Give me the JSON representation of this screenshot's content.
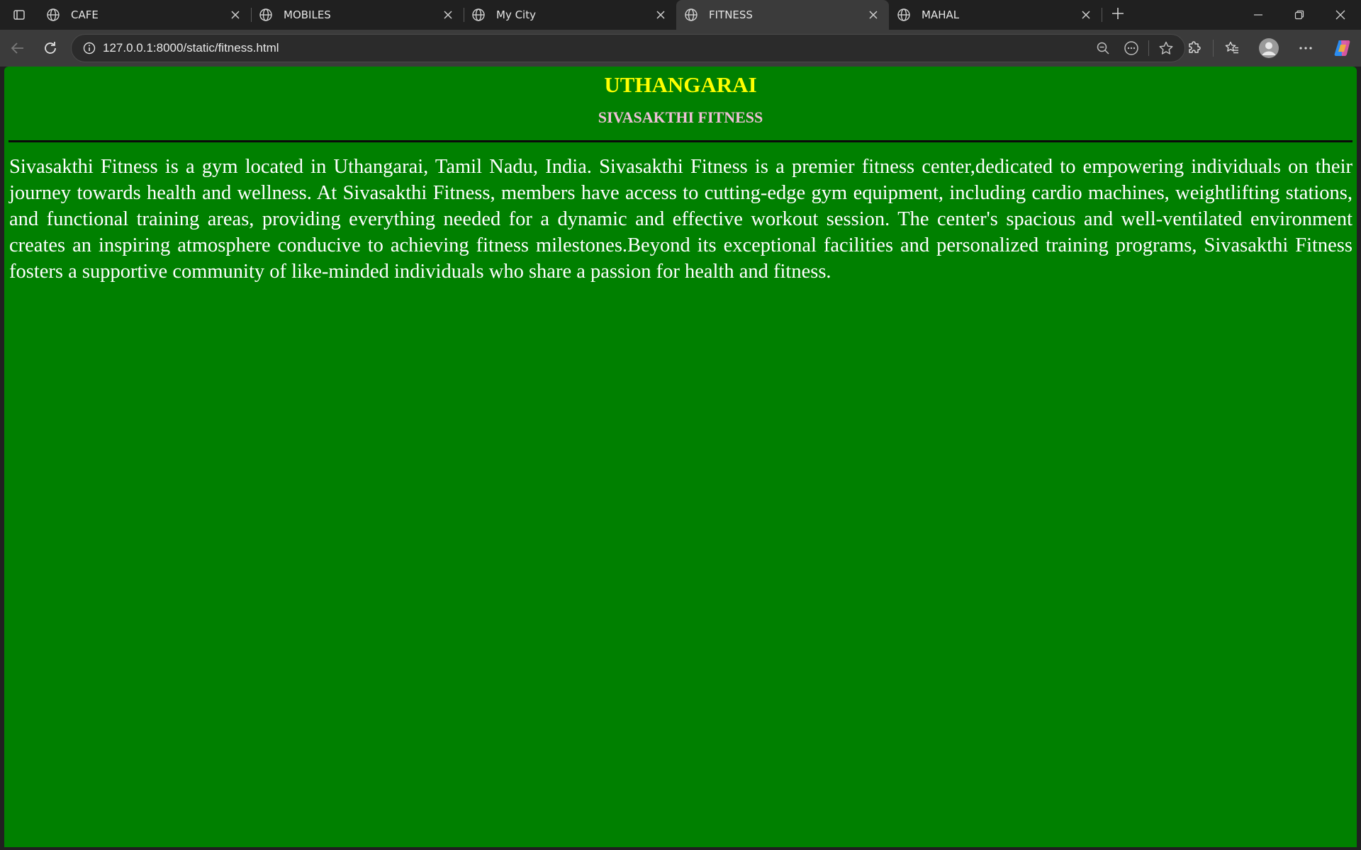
{
  "browser": {
    "tabs": [
      {
        "title": "CAFE",
        "active": false
      },
      {
        "title": "MOBILES",
        "active": false
      },
      {
        "title": "My City",
        "active": false
      },
      {
        "title": "FITNESS",
        "active": true
      },
      {
        "title": "MAHAL",
        "active": false
      }
    ],
    "url": "127.0.0.1:8000/static/fitness.html",
    "icons": {
      "tab_actions": "tab-actions-icon",
      "favicon": "globe-icon",
      "close": "close-icon",
      "new_tab": "plus-icon",
      "back": "back-arrow-icon",
      "reload": "reload-icon",
      "site_info": "info-icon",
      "zoom": "zoom-out-icon",
      "read_aloud": "more-circle-icon",
      "favorite": "star-icon",
      "extensions": "puzzle-icon",
      "favorites": "favorites-icon",
      "profile": "profile-icon",
      "menu": "ellipsis-icon",
      "copilot": "copilot-icon",
      "minimize": "minimize-icon",
      "restore": "restore-icon",
      "close_window": "close-window-icon"
    }
  },
  "page": {
    "heading": "UTHANGARAI",
    "subheading": "SIVASAKTHI FITNESS",
    "paragraph": "Sivasakthi Fitness is a gym located in Uthangarai, Tamil Nadu, India. Sivasakthi Fitness is a premier fitness center,dedicated to empowering individuals on their journey towards health and wellness. At Sivasakthi Fitness, members have access to cutting-edge gym equipment, including cardio machines, weightlifting stations, and functional training areas, providing everything needed for a dynamic and effective workout session. The center's spacious and well-ventilated environment creates an inspiring atmosphere conducive to achieving fitness milestones.Beyond its exceptional facilities and personalized training programs, Sivasakthi Fitness fosters a supportive community of like-minded individuals who share a passion for health and fitness.",
    "colors": {
      "background": "#008000",
      "heading": "#ffff00",
      "subheading": "#f0c0d8",
      "text": "#ffffff"
    }
  }
}
